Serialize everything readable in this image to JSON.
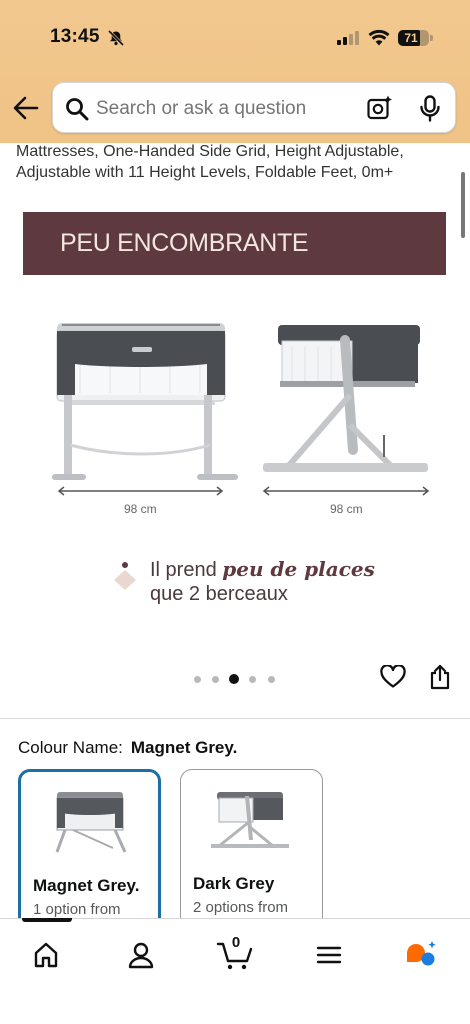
{
  "status_bar": {
    "time": "13:45",
    "battery_level": "71",
    "battery_fraction": 0.71
  },
  "header": {
    "search_placeholder": "Search or ask a question",
    "icons": [
      "back-arrow-icon",
      "search-icon",
      "camera-lens-icon",
      "microphone-icon"
    ]
  },
  "product": {
    "title": "Mattresses, One-Handed Side Grid, Height Adjustable, Adjustable with 11 Height Levels, Foldable Feet, 0m+"
  },
  "carousel": {
    "banner_text": "PEU ENCOMBRANTE",
    "measure_left": "98 cm",
    "measure_right": "98 cm",
    "tagline_prefix": "Il prend ",
    "tagline_emphasis": "peu de places",
    "tagline_line2": "que 2 berceaux",
    "dot_count": 5,
    "active_dot": 2
  },
  "colour": {
    "label": "Colour Name:",
    "selected_value": "Magnet Grey.",
    "options": [
      {
        "name": "Magnet Grey.",
        "availability": "1 option from",
        "selected": true
      },
      {
        "name": "Dark Grey",
        "availability": "2 options from",
        "selected": false
      }
    ]
  },
  "bottom_nav": {
    "items": [
      "home-icon",
      "account-icon",
      "cart-icon",
      "menu-icon",
      "rufus-icon"
    ],
    "cart_count": "0"
  },
  "colors": {
    "header_bg": "#f2c88f",
    "banner_bg": "#5e3a40",
    "selected_border": "#1b6fa6",
    "accent_orange": "#ff6a00",
    "accent_blue": "#1a7de0"
  }
}
